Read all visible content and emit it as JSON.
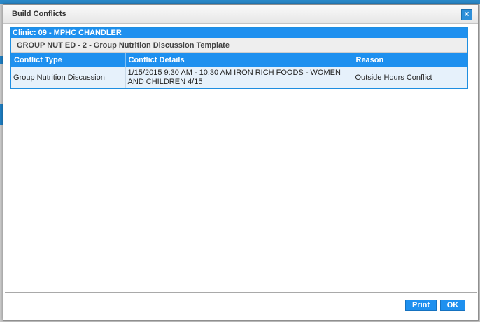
{
  "dialog": {
    "title": "Build Conflicts",
    "close_label": "×"
  },
  "clinic": {
    "label": "Clinic: 09 - MPHC CHANDLER"
  },
  "group": {
    "label": "GROUP NUT ED - 2 - Group Nutrition Discussion Template"
  },
  "table": {
    "headers": [
      "Conflict Type",
      "Conflict Details",
      "Reason"
    ],
    "rows": [
      {
        "type": "Group Nutrition Discussion",
        "details": "1/15/2015 9:30 AM - 10:30 AM IRON RICH FOODS - WOMEN AND CHILDREN 4/15",
        "reason": "Outside Hours Conflict"
      }
    ]
  },
  "buttons": {
    "print": "Print",
    "ok": "OK"
  },
  "colors": {
    "accent": "#1e90ef",
    "row_bg": "#e6f1fb"
  }
}
